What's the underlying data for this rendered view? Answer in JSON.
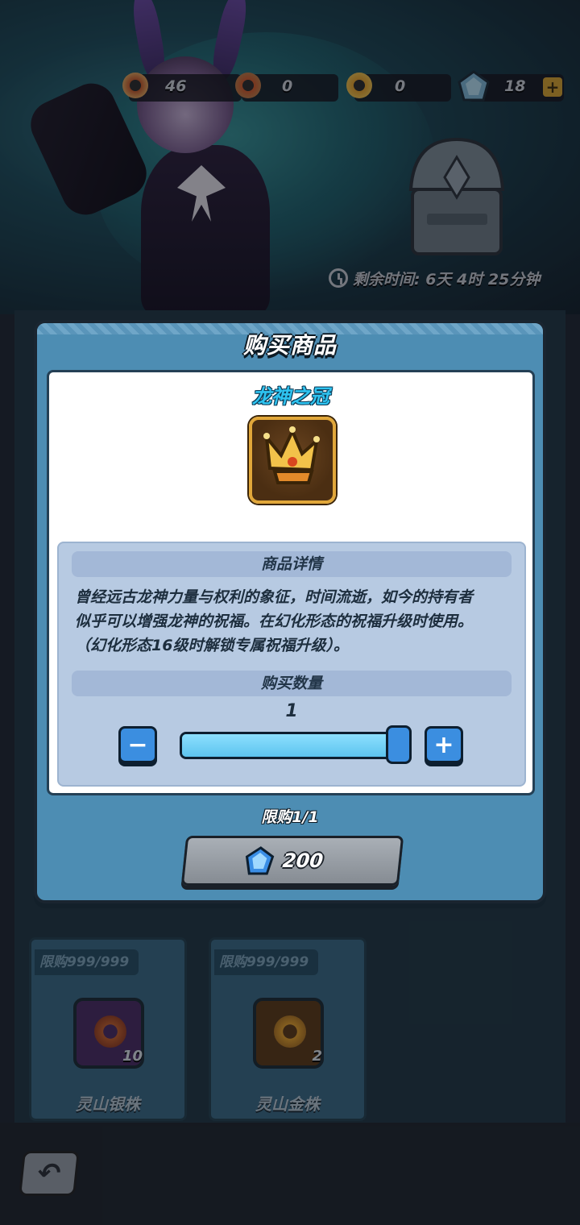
{
  "currencies": [
    {
      "name": "silver-bead",
      "value": "46"
    },
    {
      "name": "blue-bead",
      "value": "0"
    },
    {
      "name": "gold-bead",
      "value": "0"
    },
    {
      "name": "diamond",
      "value": "18"
    }
  ],
  "timer": {
    "text": "剩余时间: 6天 4时 25分钟"
  },
  "modal": {
    "title": "购买商品",
    "item_name": "龙神之冠",
    "details_header": "商品详情",
    "description_lines": [
      "曾经远古龙神力量与权利的象征，时间流逝，如今的持有者",
      "似乎可以增强龙神的祝福。在幻化形态的祝福升级时使用。",
      "（幻化形态16级时解锁专属祝福升级）。"
    ],
    "quantity_header": "购买数量",
    "quantity": "1",
    "quantity_slider_fraction": 1.0,
    "purchase_limit": "限购1/1",
    "price": "200",
    "minus_label": "−",
    "plus_label": "+"
  },
  "shop_items": [
    {
      "limit": "限购999/999",
      "count": "10",
      "name": "灵山银株",
      "color": "#4a2a63"
    },
    {
      "limit": "限购999/999",
      "count": "2",
      "name": "灵山金株",
      "color": "#5b3a15"
    }
  ],
  "colors": {
    "accent": "#3b8ee0",
    "item_name": "#2ec3f0",
    "modal_bg": "#4d8db3"
  }
}
